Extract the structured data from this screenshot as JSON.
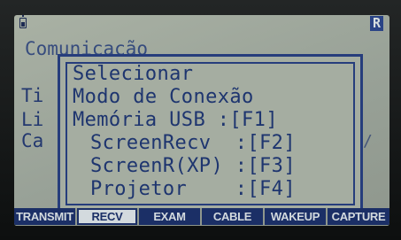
{
  "status_bar": {
    "battery_icon": "battery-icon",
    "mode_badge": "R"
  },
  "background": {
    "title": "Comunicação",
    "letters": [
      "Ti",
      "Li",
      "Ca"
    ],
    "right_glyph": "/"
  },
  "dialog": {
    "title": "Selecionar",
    "subtitle": "Modo de Conexão",
    "options": [
      {
        "label": "Memória USB ",
        "key": ":[F1]"
      },
      {
        "label": "ScreenRecv  ",
        "key": ":[F2]"
      },
      {
        "label": "ScreenR(XP) ",
        "key": ":[F3]"
      },
      {
        "label": "Projetor    ",
        "key": ":[F4]"
      }
    ]
  },
  "softkeys": [
    {
      "label": "TRANSMIT",
      "selected": false
    },
    {
      "label": "RECV",
      "selected": true
    },
    {
      "label": "EXAM",
      "selected": false
    },
    {
      "label": "CABLE",
      "selected": false
    },
    {
      "label": "WAKEUP",
      "selected": false
    },
    {
      "label": "CAPTURE",
      "selected": false
    }
  ],
  "colors": {
    "lcd": "#a5ada1",
    "ink": "#1e356f",
    "softkey_bg": "#1b2f66"
  }
}
